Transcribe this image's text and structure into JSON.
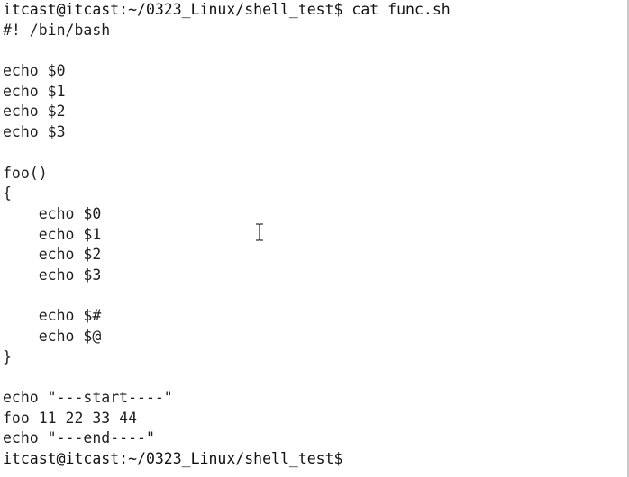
{
  "terminal": {
    "lines": [
      "itcast@itcast:~/0323_Linux/shell_test$ cat func.sh",
      "#! /bin/bash",
      "",
      "echo $0",
      "echo $1",
      "echo $2",
      "echo $3",
      "",
      "foo()",
      "{",
      "    echo $0",
      "    echo $1",
      "    echo $2",
      "    echo $3",
      "",
      "    echo $#",
      "    echo $@",
      "}",
      "",
      "echo \"---start----\"",
      "foo 11 22 33 44",
      "echo \"---end----\"",
      "itcast@itcast:~/0323_Linux/shell_test$"
    ]
  },
  "colors": {
    "background": "#ffffff",
    "text": "#1e1e1e"
  },
  "icons": {
    "mouse_cursor": "text-ibeam-cursor-icon"
  }
}
